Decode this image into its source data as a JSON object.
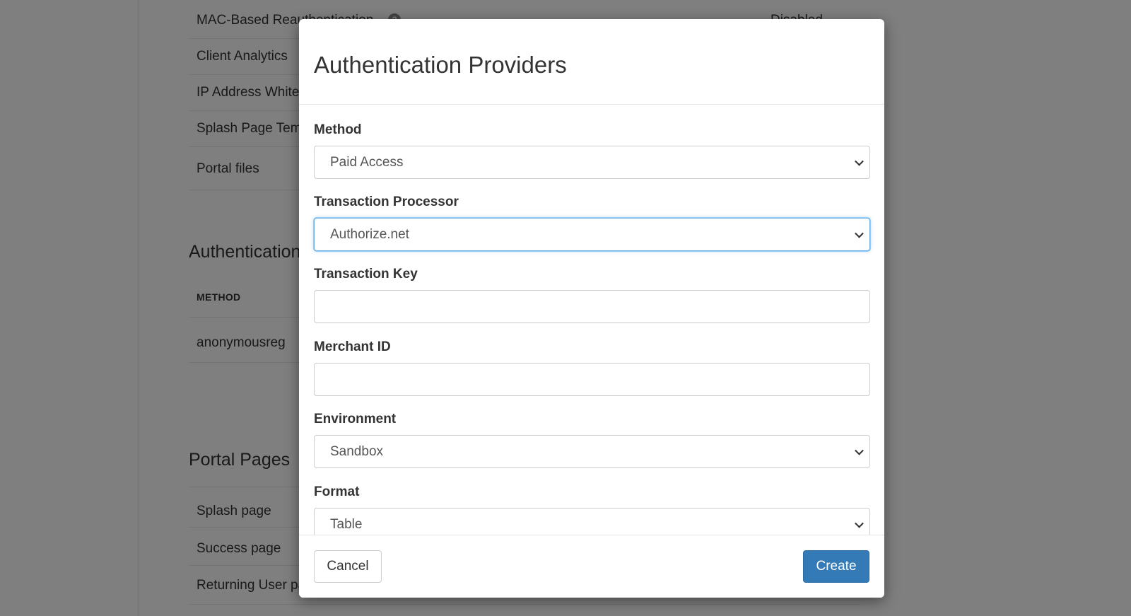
{
  "background": {
    "settings_rows": [
      {
        "label": "MAC-Based Reauthentication",
        "value": "Disabled"
      },
      {
        "label": "Client Analytics"
      },
      {
        "label": "IP Address Whitelist"
      },
      {
        "label": "Splash Page Template"
      },
      {
        "label": "Portal files"
      }
    ],
    "auth_section": {
      "title": "Authentication Providers",
      "column_header": "METHOD",
      "rows": [
        "anonymousreg"
      ]
    },
    "portal_pages": {
      "title": "Portal Pages",
      "rows": [
        "Splash page",
        "Success page",
        "Returning User page"
      ]
    },
    "help_icon": "question-circle-icon"
  },
  "modal": {
    "title": "Authentication Providers",
    "fields": {
      "method": {
        "label": "Method",
        "value": "Paid Access"
      },
      "transaction_processor": {
        "label": "Transaction Processor",
        "value": "Authorize.net"
      },
      "transaction_key": {
        "label": "Transaction Key",
        "value": ""
      },
      "merchant_id": {
        "label": "Merchant ID",
        "value": ""
      },
      "environment": {
        "label": "Environment",
        "value": "Sandbox"
      },
      "format": {
        "label": "Format",
        "value": "Table"
      }
    },
    "buttons": {
      "cancel": "Cancel",
      "create": "Create"
    }
  },
  "colors": {
    "primary": "#337ab7",
    "focus_border": "#66afe9",
    "backdrop": "rgba(0,0,0,0.5)"
  }
}
